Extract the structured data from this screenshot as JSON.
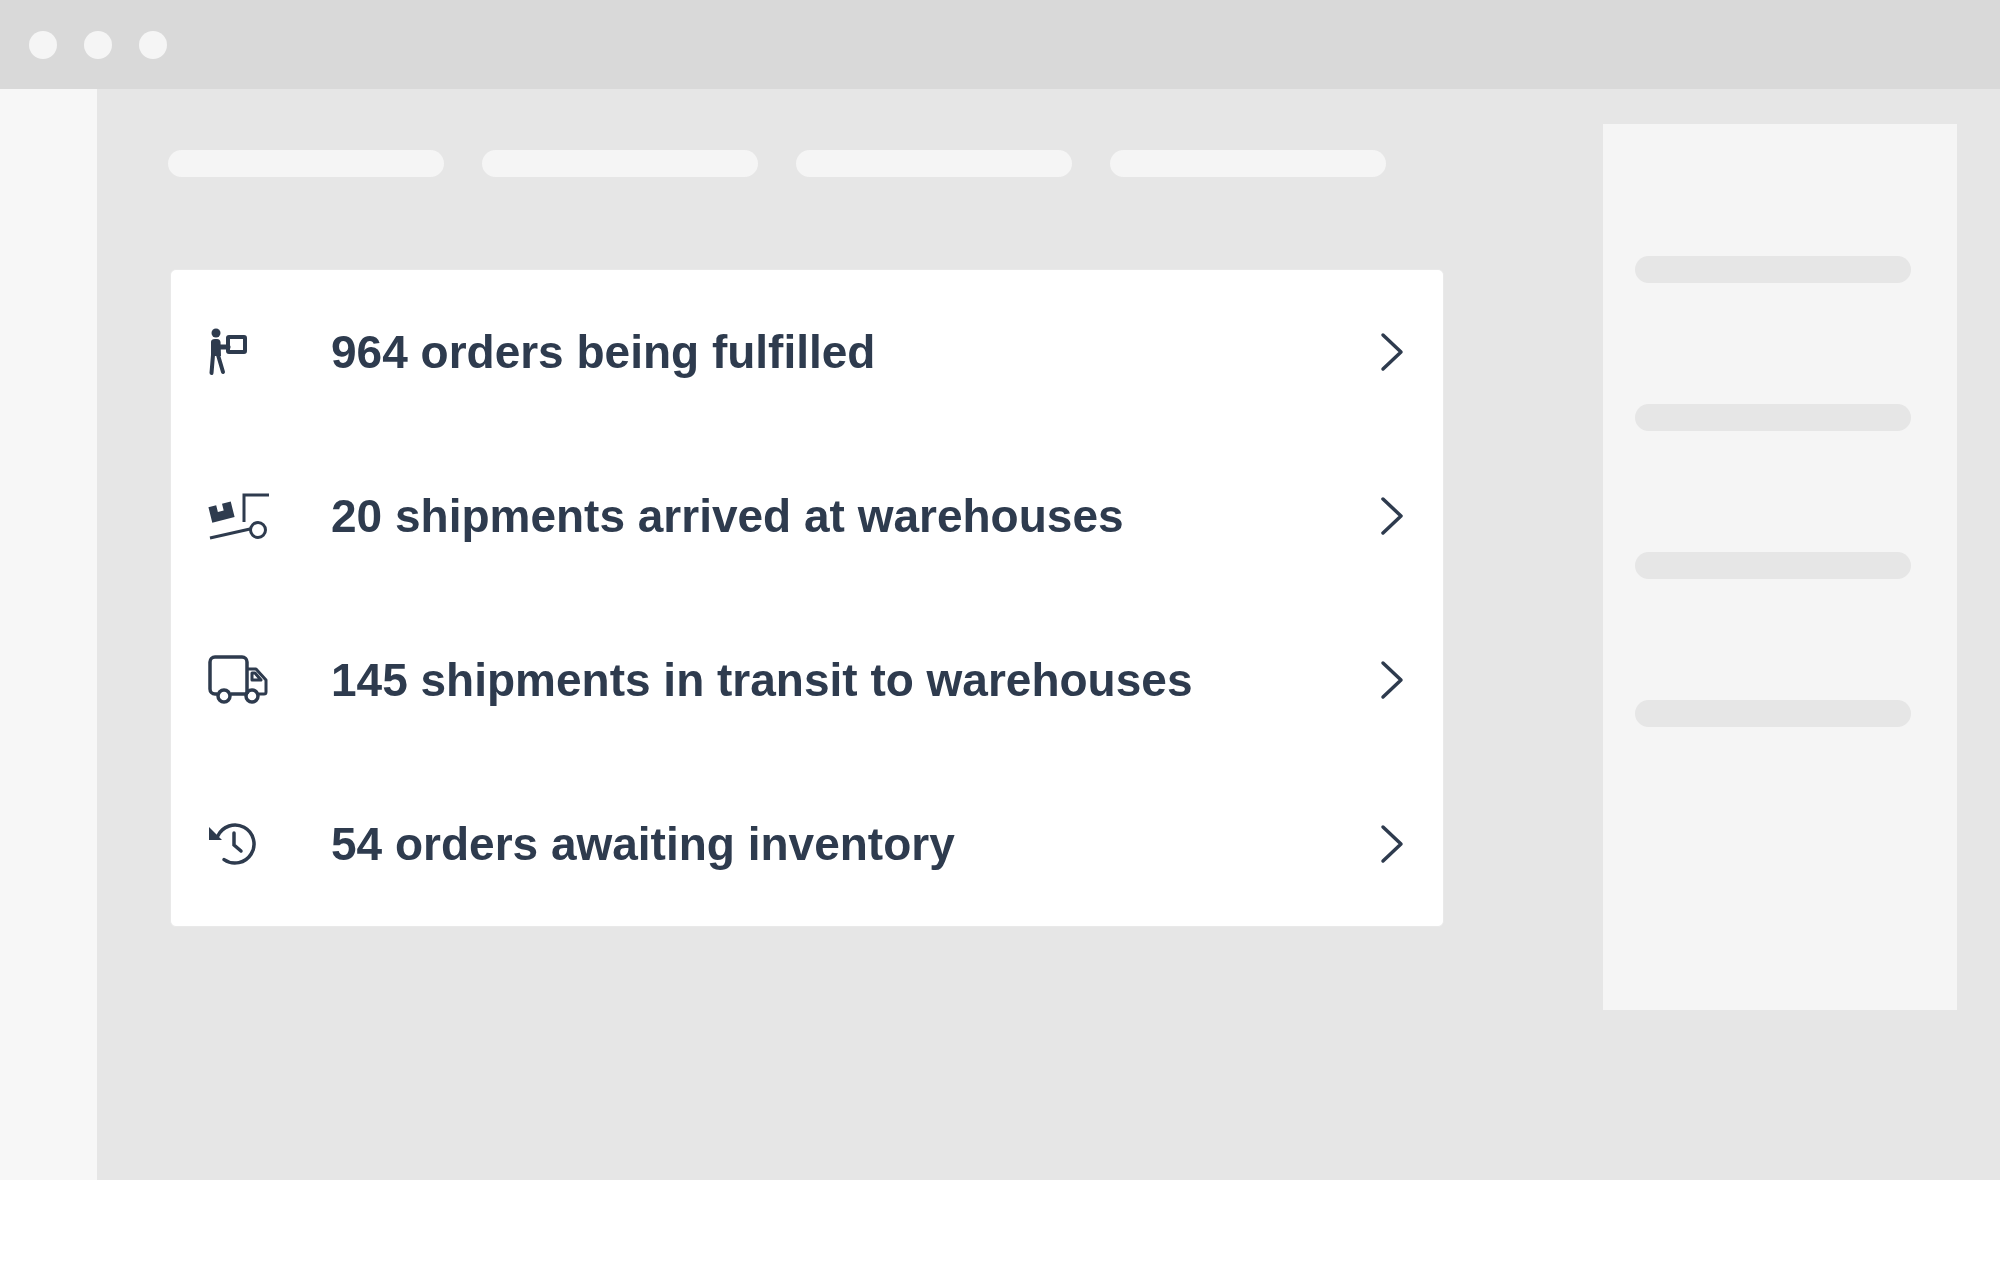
{
  "rows": [
    {
      "kind": "fulfilling",
      "label": "964 orders being fulfilled"
    },
    {
      "kind": "arrived",
      "label": "20 shipments arrived at warehouses"
    },
    {
      "kind": "transit",
      "label": "145 shipments in transit to warehouses"
    },
    {
      "kind": "awaiting",
      "label": "54 orders awaiting inventory"
    }
  ]
}
